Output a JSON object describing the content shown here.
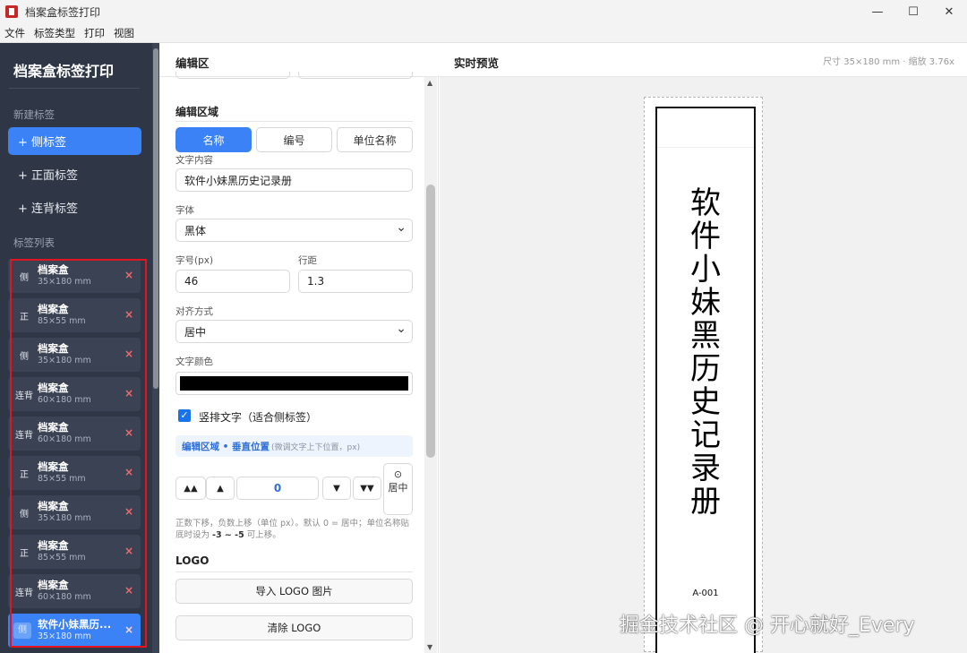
{
  "window": {
    "title": "档案盒标签打印",
    "controls": {
      "minimize": "—",
      "maximize": "☐",
      "close": "✕"
    }
  },
  "menu": [
    "文件",
    "标签类型",
    "打印",
    "视图"
  ],
  "sidebar": {
    "brand": "档案盒标签打印",
    "new_section": "新建标签",
    "new_buttons": [
      "+ 侧标签",
      "+ 正面标签",
      "+ 连背标签"
    ],
    "list_section": "标签列表",
    "items": [
      {
        "type": "侧",
        "name": "档案盒",
        "size": "35×180 mm"
      },
      {
        "type": "正",
        "name": "档案盒",
        "size": "85×55 mm"
      },
      {
        "type": "侧",
        "name": "档案盒",
        "size": "35×180 mm"
      },
      {
        "type": "连背",
        "name": "档案盒",
        "size": "60×180 mm"
      },
      {
        "type": "连背",
        "name": "档案盒",
        "size": "60×180 mm"
      },
      {
        "type": "正",
        "name": "档案盒",
        "size": "85×55 mm"
      },
      {
        "type": "侧",
        "name": "档案盒",
        "size": "35×180 mm"
      },
      {
        "type": "正",
        "name": "档案盒",
        "size": "85×55 mm"
      },
      {
        "type": "连背",
        "name": "档案盒",
        "size": "60×180 mm"
      },
      {
        "type": "侧",
        "name": "软件小妹黑历...",
        "size": "35×180 mm"
      }
    ],
    "close_glyph": "×"
  },
  "editor": {
    "title": "编辑区",
    "area_section": "编辑区域",
    "segments": [
      "名称",
      "编号",
      "单位名称"
    ],
    "text_label": "文字内容",
    "text_value": "软件小妹黑历史记录册",
    "font_label": "字体",
    "font_value": "黑体",
    "size_label": "字号(px)",
    "size_value": "46",
    "line_label": "行距",
    "line_value": "1.3",
    "align_label": "对齐方式",
    "align_value": "居中",
    "color_label": "文字颜色",
    "text_color": "#000000",
    "vertical_label": "竖排文字（适合侧标签）",
    "vertical_checked": true,
    "vpos_title": "编辑区域 • 垂直位置",
    "vpos_hint": "(微调文字上下位置，px)",
    "steps": {
      "up2": "▲▲",
      "up1": "▲",
      "value": "0",
      "down1": "▼",
      "down2": "▼▼"
    },
    "center_icon": "⊙",
    "center_label": "居中",
    "hint_prefix": "正数下移，负数上移（单位 px）。默认 0 = 居中；单位名称贴底时设为 ",
    "hint_bold": "-3 ~ -5",
    "hint_suffix": " 可上移。",
    "logo_section": "LOGO",
    "logo_import": "导入 LOGO 图片",
    "logo_clear": "清除 LOGO"
  },
  "preview": {
    "title": "实时预览",
    "meta": "尺寸 35×180 mm · 缩放 3.76x",
    "label_text": "软件小妹黑历史记录册",
    "label_code": "A-001"
  },
  "watermark": "掘金技术社区 @ 开心就好_Every",
  "colors": {
    "accent": "#3b82f6",
    "sidebar_bg": "#2f3747",
    "highlight": "#e3141f"
  }
}
